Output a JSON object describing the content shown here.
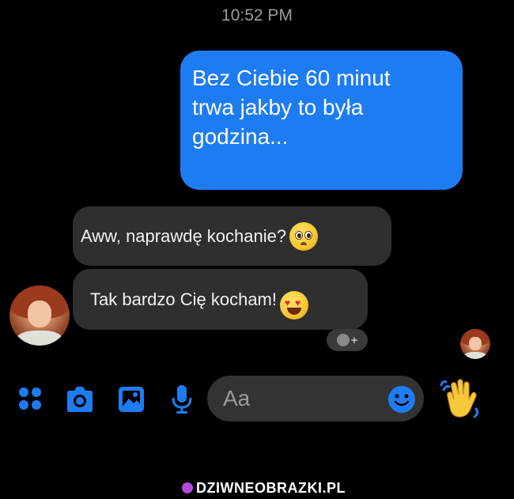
{
  "status": {
    "time": "10:52 PM"
  },
  "messages": [
    {
      "direction": "outgoing",
      "lines": [
        "Bez Ciebie 60 minut",
        "trwa jakby to była",
        "godzina..."
      ]
    },
    {
      "direction": "incoming",
      "text": "Aww, naprawdę kochanie?",
      "emoji": "pleading-face"
    },
    {
      "direction": "incoming",
      "text": "Tak bardzo Cię kocham!",
      "emoji": "heart-eyes-face"
    }
  ],
  "composer": {
    "placeholder": "Aa",
    "icons": [
      "menu-dots-icon",
      "camera-icon",
      "gallery-icon",
      "microphone-icon",
      "emoji-icon",
      "wave-hand-icon"
    ]
  },
  "watermark": {
    "text": "DZIWNEOBRAZKI.PL"
  },
  "colors": {
    "accent": "#1e7cf2",
    "background": "#000000",
    "incoming_bubble": "#2f2f2f"
  }
}
